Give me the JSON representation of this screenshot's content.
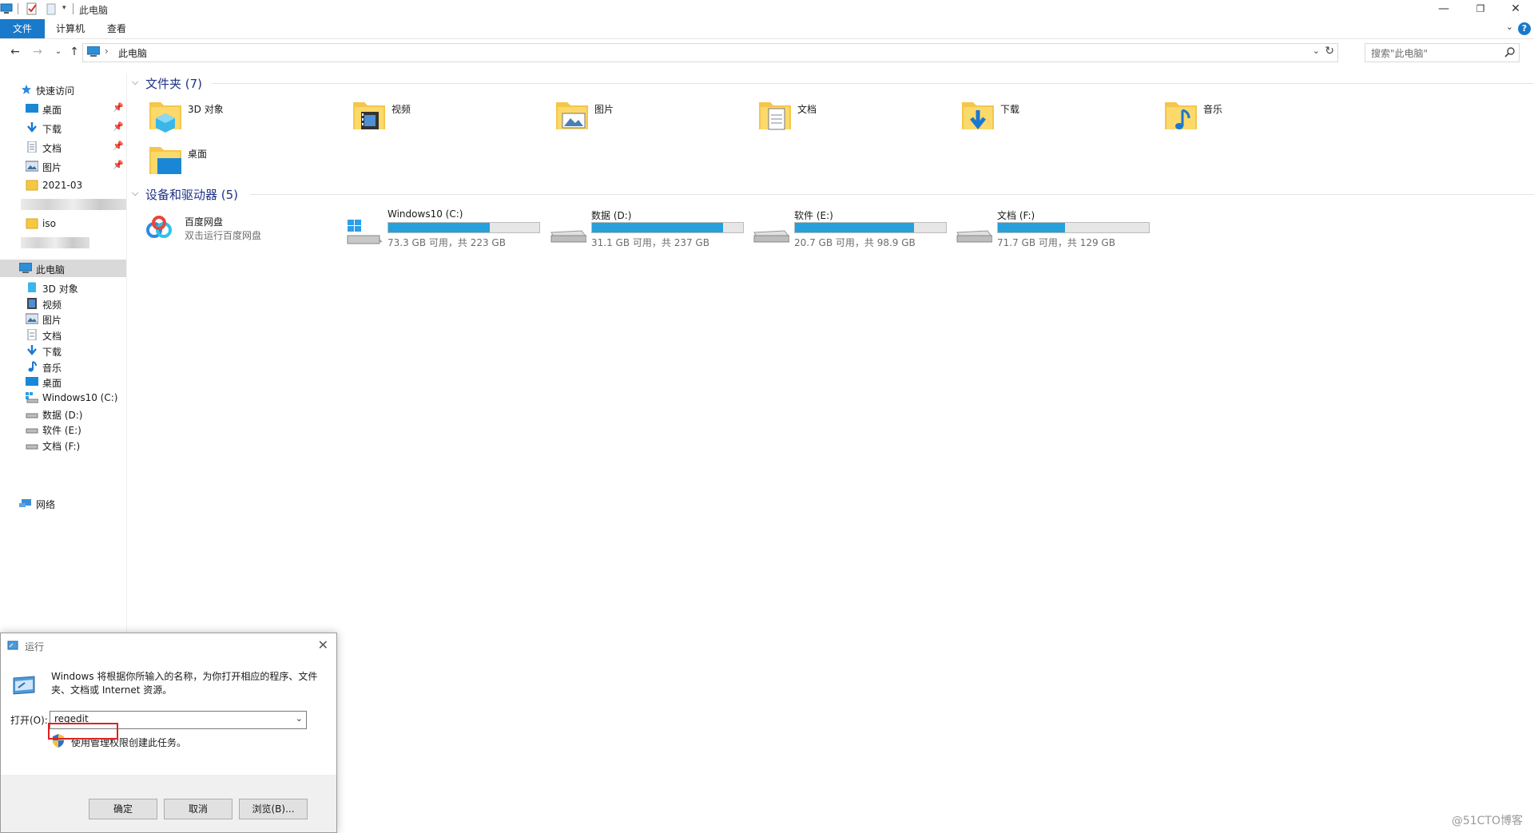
{
  "window": {
    "title": "此电脑",
    "controls": {
      "minimize": "—",
      "maximize": "❐",
      "close": "✕"
    }
  },
  "ribbon": {
    "tabs": [
      "文件",
      "计算机",
      "查看"
    ],
    "expand_glyph": "⌄",
    "help": "?"
  },
  "address": {
    "path": "此电脑",
    "search_placeholder": "搜索\"此电脑\""
  },
  "sidebar": {
    "quick_access": "快速访问",
    "pinned": [
      {
        "label": "桌面",
        "icon": "desktop-icon"
      },
      {
        "label": "下载",
        "icon": "download-icon"
      },
      {
        "label": "文档",
        "icon": "document-icon"
      },
      {
        "label": "图片",
        "icon": "picture-icon"
      }
    ],
    "recent": [
      "2021-03",
      "iso"
    ],
    "this_pc": "此电脑",
    "pc_items": [
      {
        "label": "3D 对象",
        "icon": "3d-objects-icon"
      },
      {
        "label": "视频",
        "icon": "video-icon"
      },
      {
        "label": "图片",
        "icon": "picture-icon"
      },
      {
        "label": "文档",
        "icon": "document-icon"
      },
      {
        "label": "下载",
        "icon": "download-icon"
      },
      {
        "label": "音乐",
        "icon": "music-icon"
      },
      {
        "label": "桌面",
        "icon": "desktop-icon"
      },
      {
        "label": "Windows10 (C:)",
        "icon": "windows-drive-icon"
      },
      {
        "label": "数据 (D:)",
        "icon": "drive-icon"
      },
      {
        "label": "软件 (E:)",
        "icon": "drive-icon"
      },
      {
        "label": "文档 (F:)",
        "icon": "drive-icon"
      }
    ],
    "network": "网络"
  },
  "main": {
    "folders_header": "文件夹 (7)",
    "folders": [
      {
        "label": "3D 对象",
        "icon": "3d-objects-folder-icon"
      },
      {
        "label": "视频",
        "icon": "video-folder-icon"
      },
      {
        "label": "图片",
        "icon": "pictures-folder-icon"
      },
      {
        "label": "文档",
        "icon": "documents-folder-icon"
      },
      {
        "label": "下载",
        "icon": "downloads-folder-icon"
      },
      {
        "label": "音乐",
        "icon": "music-folder-icon"
      },
      {
        "label": "桌面",
        "icon": "desktop-folder-icon"
      }
    ],
    "devices_header": "设备和驱动器 (5)",
    "baidu": {
      "name": "百度网盘",
      "sub": "双击运行百度网盘"
    },
    "drives": [
      {
        "name": "Windows10 (C:)",
        "sub": "73.3 GB 可用，共 223 GB",
        "used_fraction": 0.671
      },
      {
        "name": "数据 (D:)",
        "sub": "31.1 GB 可用，共 237 GB",
        "used_fraction": 0.869
      },
      {
        "name": "软件 (E:)",
        "sub": "20.7 GB 可用，共 98.9 GB",
        "used_fraction": 0.791
      },
      {
        "name": "文档 (F:)",
        "sub": "71.7 GB 可用，共 129 GB",
        "used_fraction": 0.444
      }
    ],
    "accent_color": "#26a0da"
  },
  "run_dialog": {
    "title": "运行",
    "description": "Windows 将根据你所输入的名称，为你打开相应的程序、文件夹、文档或 Internet 资源。",
    "open_label": "打开(O):",
    "open_value": "regedit",
    "admin_note": "使用管理权限创建此任务。",
    "ok": "确定",
    "cancel": "取消",
    "browse": "浏览(B)..."
  },
  "watermark": "@51CTO博客"
}
